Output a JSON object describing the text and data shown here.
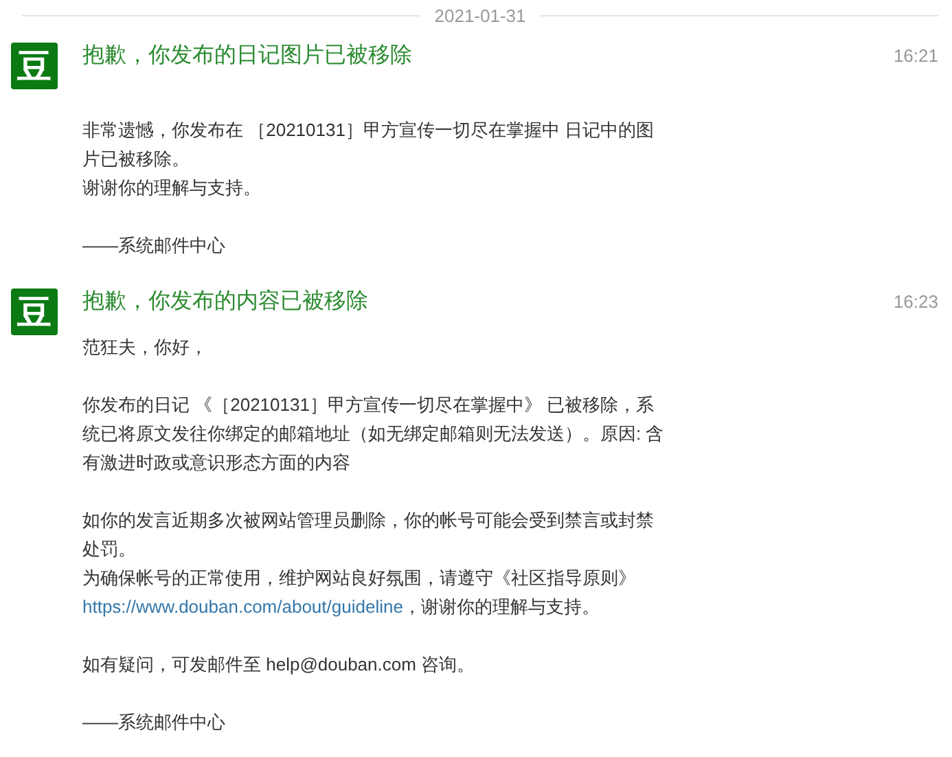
{
  "date_divider": "2021-01-31",
  "messages": [
    {
      "avatar": "豆",
      "title": "抱歉，你发布的日记图片已被移除",
      "time": "16:21",
      "body_gap": true,
      "paragraphs": [
        [
          {
            "kind": "text",
            "lines": [
              "非常遗憾，你发布在 ［20210131］甲方宣传一切尽在掌握中 日记中的图",
              "片已被移除。",
              "谢谢你的理解与支持。"
            ]
          }
        ],
        [
          {
            "kind": "text",
            "lines": [
              "——系统邮件中心"
            ]
          }
        ]
      ]
    },
    {
      "avatar": "豆",
      "title": "抱歉，你发布的内容已被移除",
      "time": "16:23",
      "body_gap": false,
      "paragraphs": [
        [
          {
            "kind": "text",
            "lines": [
              "范狂夫，你好，"
            ]
          }
        ],
        [
          {
            "kind": "text",
            "lines": [
              "你发布的日记 《［20210131］甲方宣传一切尽在掌握中》 已被移除，系",
              "统已将原文发往你绑定的邮箱地址（如无绑定邮箱则无法发送）。原因: 含",
              "有激进时政或意识形态方面的内容"
            ]
          }
        ],
        [
          {
            "kind": "text",
            "lines": [
              "如你的发言近期多次被网站管理员删除，你的帐号可能会受到禁言或封禁",
              "处罚。",
              "为确保帐号的正常使用，维护网站良好氛围，请遵守《社区指导原则》"
            ]
          },
          {
            "kind": "link",
            "text": "https://www.douban.com/about/guideline"
          },
          {
            "kind": "text",
            "lines": [
              "，谢谢你的理解与支持。"
            ]
          }
        ],
        [
          {
            "kind": "text",
            "lines": [
              "如有疑问，可发邮件至 help@douban.com 咨询。"
            ]
          }
        ],
        [
          {
            "kind": "text",
            "lines": [
              "——系统邮件中心"
            ]
          }
        ]
      ]
    }
  ]
}
